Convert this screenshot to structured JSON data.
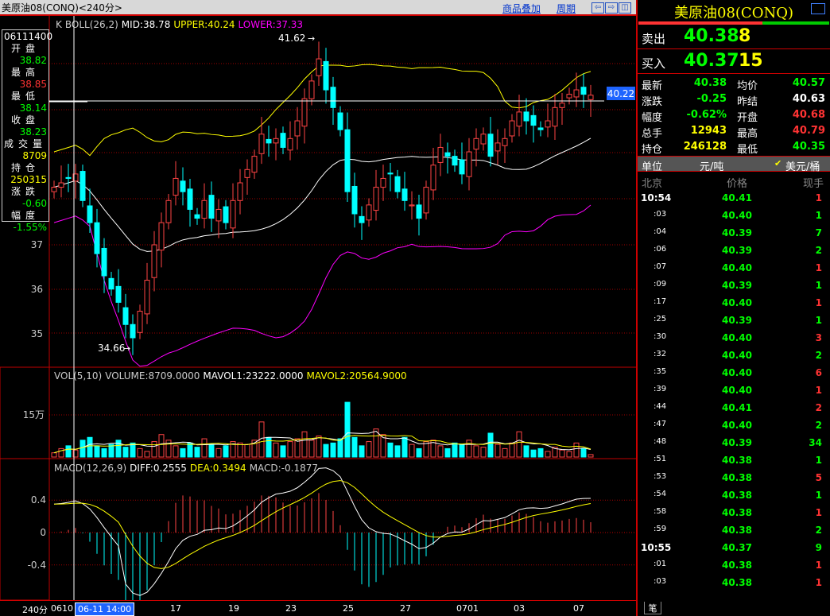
{
  "title": "美原油08(CONQ)<240分>",
  "toolbar": {
    "overlay": "商品叠加",
    "period": "周期",
    "left": "⇦",
    "right": "⇨",
    "layout": "◫"
  },
  "boll": {
    "k": "K",
    "name": "BOLL(26,2)",
    "mid": "MID:38.78",
    "upper": "UPPER:40.24",
    "lower": "LOWER:37.33"
  },
  "price_marks": {
    "high": "41.62",
    "low": "34.66",
    "current": "40.22"
  },
  "price_axis": [
    "37",
    "36",
    "35"
  ],
  "vol": {
    "name": "VOL(5,10)",
    "volume": "VOLUME:8709.0000",
    "mavol1": "MAVOL1:23222.0000",
    "mavol2": "MAVOL2:20564.9000",
    "axis": "15万"
  },
  "macd": {
    "name": "MACD(12,26,9)",
    "diff": "DIFF:0.2555",
    "dea": "DEA:0.3494",
    "macd": "MACD:-0.1877",
    "axis": [
      "0.4",
      "0",
      "-0.4"
    ]
  },
  "xaxis": {
    "period": "240分",
    "cursor": "06-11 14:00",
    "labels": [
      "0610",
      "17",
      "19",
      "23",
      "25",
      "27",
      "0701",
      "03",
      "07"
    ]
  },
  "info": {
    "time": "06111400",
    "rows": [
      {
        "label": "开盘",
        "value": "38.82",
        "color": "#00ff00"
      },
      {
        "label": "最高",
        "value": "38.85",
        "color": "#ff3333"
      },
      {
        "label": "最低",
        "value": "38.14",
        "color": "#00ff00"
      },
      {
        "label": "收盘",
        "value": "38.23",
        "color": "#00ff00"
      },
      {
        "label": "成交量",
        "value": "8709",
        "color": "#ffff00"
      },
      {
        "label": "持仓",
        "value": "250315",
        "color": "#ffff00"
      },
      {
        "label": "涨跌",
        "value": "-0.60",
        "color": "#00ff00"
      },
      {
        "label": "幅度",
        "value": "-1.55%",
        "color": "#00ff00"
      }
    ]
  },
  "panel": {
    "title": "美原油08(CONQ)",
    "ratio_red": 0.65,
    "sell": {
      "label": "卖出",
      "price": "40.38",
      "qty": "8"
    },
    "buy": {
      "label": "买入",
      "price": "40.37",
      "qty": "15"
    },
    "stats": [
      {
        "l1": "最新",
        "v1": "40.38",
        "c1": "#00ff00",
        "l2": "均价",
        "v2": "40.57",
        "c2": "#00ff00"
      },
      {
        "l1": "涨跌",
        "v1": "-0.25",
        "c1": "#00ff00",
        "l2": "昨结",
        "v2": "40.63",
        "c2": "#ffffff"
      },
      {
        "l1": "幅度",
        "v1": "-0.62%",
        "c1": "#00ff00",
        "l2": "开盘",
        "v2": "40.68",
        "c2": "#ff3333"
      },
      {
        "l1": "总手",
        "v1": "12943",
        "c1": "#ffff00",
        "l2": "最高",
        "v2": "40.79",
        "c2": "#ff3333"
      },
      {
        "l1": "持仓",
        "v1": "246128",
        "c1": "#ffff00",
        "l2": "最低",
        "v2": "40.35",
        "c2": "#00ff00"
      }
    ],
    "unit": {
      "label": "单位",
      "opt1": "元/吨",
      "opt2": "美元/桶",
      "check": "✔"
    },
    "ticks_header": {
      "time": "北京",
      "price": "价格",
      "vol": "现手"
    },
    "ticks": [
      {
        "t": "10:54",
        "p": "40.41",
        "v": "1",
        "vc": "r",
        "full": true
      },
      {
        "t": ":03",
        "p": "40.40",
        "v": "1",
        "vc": "g"
      },
      {
        "t": ":04",
        "p": "40.39",
        "v": "7",
        "vc": "g"
      },
      {
        "t": ":06",
        "p": "40.39",
        "v": "2",
        "vc": "g"
      },
      {
        "t": ":07",
        "p": "40.40",
        "v": "1",
        "vc": "r"
      },
      {
        "t": ":09",
        "p": "40.39",
        "v": "1",
        "vc": "g"
      },
      {
        "t": ":17",
        "p": "40.40",
        "v": "1",
        "vc": "r"
      },
      {
        "t": ":25",
        "p": "40.39",
        "v": "1",
        "vc": "g"
      },
      {
        "t": ":30",
        "p": "40.40",
        "v": "3",
        "vc": "r"
      },
      {
        "t": ":32",
        "p": "40.40",
        "v": "2",
        "vc": "g"
      },
      {
        "t": ":35",
        "p": "40.40",
        "v": "6",
        "vc": "r"
      },
      {
        "t": ":39",
        "p": "40.40",
        "v": "1",
        "vc": "r"
      },
      {
        "t": ":44",
        "p": "40.41",
        "v": "2",
        "vc": "r"
      },
      {
        "t": ":47",
        "p": "40.40",
        "v": "2",
        "vc": "g"
      },
      {
        "t": ":48",
        "p": "40.39",
        "v": "34",
        "vc": "g"
      },
      {
        "t": ":51",
        "p": "40.38",
        "v": "1",
        "vc": "g"
      },
      {
        "t": ":53",
        "p": "40.38",
        "v": "5",
        "vc": "r"
      },
      {
        "t": ":54",
        "p": "40.38",
        "v": "1",
        "vc": "g"
      },
      {
        "t": ":58",
        "p": "40.38",
        "v": "1",
        "vc": "r"
      },
      {
        "t": ":59",
        "p": "40.38",
        "v": "2",
        "vc": "g"
      },
      {
        "t": "10:55",
        "p": "40.37",
        "v": "9",
        "vc": "g",
        "full": true
      },
      {
        "t": ":01",
        "p": "40.38",
        "v": "1",
        "vc": "r"
      },
      {
        "t": ":03",
        "p": "40.38",
        "v": "1",
        "vc": "r"
      }
    ],
    "bottom_tab": "笔"
  },
  "colors": {
    "up": "#ff4444",
    "down": "#00ffff",
    "mid": "#ffffff",
    "upper": "#ffff00",
    "lower": "#ff00ff",
    "grid": "#c00000"
  },
  "chart_data": {
    "type": "candlestick",
    "close": [
      38.3,
      38.4,
      38.5,
      38.6,
      38.0,
      37.5,
      36.8,
      36.3,
      36.0,
      35.7,
      35.2,
      34.9,
      35.5,
      36.2,
      37.0,
      37.5,
      38.0,
      38.5,
      38.2,
      37.8,
      37.6,
      38.0,
      37.6,
      37.8,
      37.5,
      38.0,
      38.4,
      38.7,
      39.0,
      39.5,
      39.3,
      39.4,
      39.2,
      39.4,
      39.8,
      40.3,
      40.7,
      41.2,
      40.5,
      40.1,
      39.6,
      38.2,
      37.7,
      37.5,
      37.9,
      38.3,
      38.5,
      38.6,
      38.2,
      38.0,
      37.9,
      37.6,
      38.3,
      38.8,
      39.2,
      39.0,
      38.8,
      38.6,
      39.1,
      39.4,
      39.5,
      39.0,
      39.3,
      39.4,
      39.8,
      40.0,
      39.8,
      39.7,
      39.6,
      39.8,
      40.1,
      40.2,
      40.4,
      40.5,
      40.4,
      40.38
    ],
    "volume": [
      15000,
      30000,
      40000,
      25000,
      60000,
      70000,
      40000,
      30000,
      45000,
      60000,
      35000,
      50000,
      30000,
      20000,
      55000,
      80000,
      60000,
      40000,
      30000,
      50000,
      35000,
      65000,
      45000,
      30000,
      40000,
      55000,
      50000,
      45000,
      60000,
      125000,
      70000,
      50000,
      40000,
      55000,
      65000,
      90000,
      60000,
      75000,
      45000,
      50000,
      65000,
      195000,
      70000,
      40000,
      55000,
      100000,
      80000,
      50000,
      40000,
      70000,
      45000,
      30000,
      55000,
      60000,
      40000,
      30000,
      50000,
      45000,
      60000,
      40000,
      35000,
      85000,
      45000,
      30000,
      50000,
      90000,
      40000,
      25000,
      30000,
      20000,
      35000,
      25000,
      20000,
      50000,
      30000,
      8709
    ],
    "ylim": [
      34.5,
      42.0
    ],
    "vol_axis": 150000,
    "macd_axis": [
      -0.4,
      0.4
    ]
  }
}
